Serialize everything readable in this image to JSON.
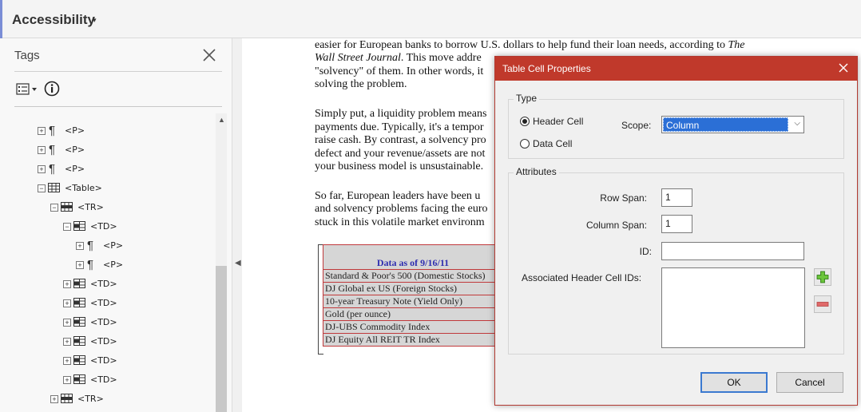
{
  "header": {
    "title": "Accessibility",
    "caret": "▾"
  },
  "tags_panel": {
    "title": "Tags",
    "tree": [
      {
        "label": "<P>",
        "level": 0,
        "expander": "+",
        "kind": "p"
      },
      {
        "label": "<P>",
        "level": 0,
        "expander": "+",
        "kind": "p"
      },
      {
        "label": "<P>",
        "level": 0,
        "expander": "+",
        "kind": "p"
      },
      {
        "label": "<Table>",
        "level": 0,
        "expander": "−",
        "kind": "table"
      },
      {
        "label": "<TR>",
        "level": 1,
        "expander": "−",
        "kind": "tr"
      },
      {
        "label": "<TD>",
        "level": 2,
        "expander": "−",
        "kind": "td"
      },
      {
        "label": "<P>",
        "level": 3,
        "expander": "+",
        "kind": "p"
      },
      {
        "label": "<P>",
        "level": 3,
        "expander": "+",
        "kind": "p"
      },
      {
        "label": "<TD>",
        "level": 2,
        "expander": "+",
        "kind": "td"
      },
      {
        "label": "<TD>",
        "level": 2,
        "expander": "+",
        "kind": "td"
      },
      {
        "label": "<TD>",
        "level": 2,
        "expander": "+",
        "kind": "td"
      },
      {
        "label": "<TD>",
        "level": 2,
        "expander": "+",
        "kind": "td"
      },
      {
        "label": "<TD>",
        "level": 2,
        "expander": "+",
        "kind": "td"
      },
      {
        "label": "<TD>",
        "level": 2,
        "expander": "+",
        "kind": "td"
      },
      {
        "label": "<TR>",
        "level": 1,
        "expander": "+",
        "kind": "tr"
      }
    ]
  },
  "document": {
    "lines": [
      {
        "text": "easier for European banks to borrow U.S. dollars to help fund their loan needs, according to ",
        "italic": "The"
      },
      {
        "text": "",
        "italic": "Wall Street Journal",
        "after": ". This move addre"
      },
      {
        "text": "\"solvency\" of them. In other words, it"
      },
      {
        "text": "solving the problem."
      },
      {
        "text": "Simply put, a liquidity problem means"
      },
      {
        "text": "payments due. Typically, it's a tempor"
      },
      {
        "text": "raise cash. By contrast, a solvency pro"
      },
      {
        "text": "defect and your revenue/assets are not"
      },
      {
        "text": "your business model is unsustainable."
      },
      {
        "text": "So far, European leaders have been u"
      },
      {
        "text": "and solvency problems facing the euro"
      },
      {
        "text": "stuck in this volatile market environm"
      }
    ],
    "table": {
      "header": "Data as of 9/16/11",
      "rows": [
        "Standard & Poor's 500 (Domestic Stocks)",
        "DJ Global ex US (Foreign Stocks)",
        "10-year Treasury Note (Yield Only)",
        "Gold (per ounce)",
        "DJ-UBS Commodity Index",
        "DJ Equity All REIT TR Index"
      ]
    }
  },
  "dialog": {
    "title": "Table Cell Properties",
    "type_group": "Type",
    "header_cell": "Header Cell",
    "data_cell": "Data Cell",
    "selected_type": "Header Cell",
    "scope_label": "Scope:",
    "scope_value": "Column",
    "attributes_group": "Attributes",
    "row_span_label": "Row Span:",
    "row_span_value": "1",
    "column_span_label": "Column Span:",
    "column_span_value": "1",
    "id_label": "ID:",
    "id_value": "",
    "assoc_label": "Associated Header Cell IDs:",
    "ok": "OK",
    "cancel": "Cancel"
  },
  "colors": {
    "accent_red": "#c0392b",
    "tree_bg": "#f8f8f8",
    "highlight_blue": "#2b6fd6"
  }
}
